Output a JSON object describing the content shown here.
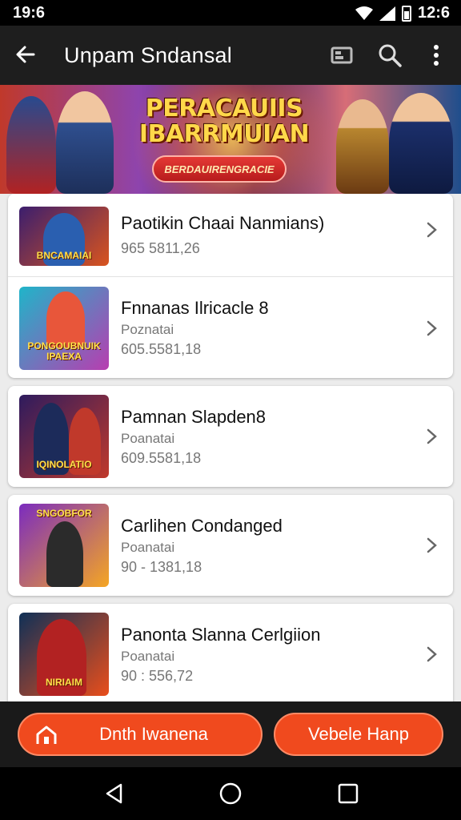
{
  "status_bar": {
    "time": "19:6",
    "clock": "12:6"
  },
  "app_bar": {
    "title": "Unpam Sndansal"
  },
  "banner": {
    "title_line1": "PERACAUIIS",
    "title_line2": "IBARRMUIAN",
    "cta": "BERDAUIRENGRACIE"
  },
  "list": [
    {
      "title": "Paotikin Chaai Nanmians)",
      "subtitle": "",
      "meta": "965 5811,26",
      "thumb_label": "BNCAMAIAI",
      "thumb_colors": [
        "#3b1e6e",
        "#d9541e"
      ]
    },
    {
      "title": "Fnnanas Ilricacle 8",
      "subtitle": "Poznatai",
      "meta": "605.5581,18",
      "thumb_label": "PONGOUBNUIK IPAEXA",
      "thumb_colors": [
        "#1fb5c9",
        "#b83db0"
      ]
    },
    {
      "title": "Pamnan Slapden8",
      "subtitle": "Poanatai",
      "meta": "609.5581,18",
      "thumb_label": "IQINOLATIO",
      "thumb_colors": [
        "#2d1b5e",
        "#c0392b"
      ]
    },
    {
      "title": "Carlihen Condanged",
      "subtitle": "Poanatai",
      "meta": "90 - 1381,18",
      "thumb_label": "SNGOBFOR",
      "thumb_colors": [
        "#7b2cbf",
        "#f5a623"
      ]
    },
    {
      "title": "Panonta Slanna Cerlgiion",
      "subtitle": "Poanatai",
      "meta": "90 : 556,72",
      "thumb_label": "NIRIAIM",
      "thumb_colors": [
        "#0f3057",
        "#e94e1b"
      ]
    }
  ],
  "actions": {
    "left_label": "Dnth Iwanena",
    "right_label": "Vebele Hanp"
  },
  "colors": {
    "accent": "#f04a1e",
    "app_bar": "#1e1e1e",
    "list_bg": "#ececec"
  }
}
